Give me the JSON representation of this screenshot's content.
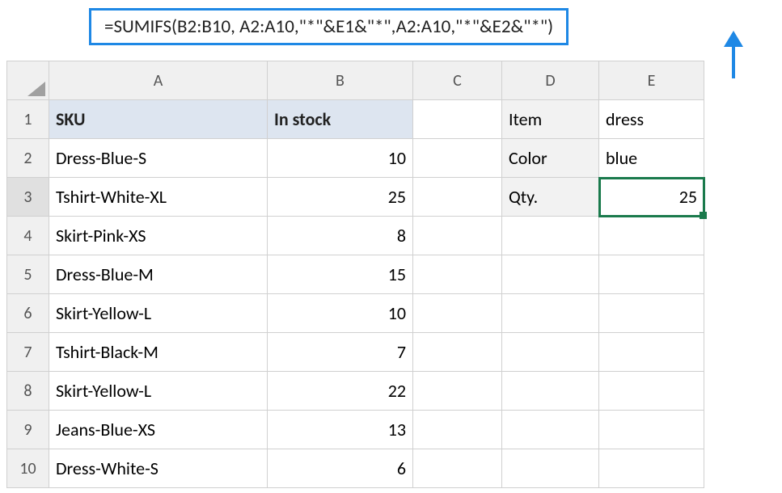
{
  "formula": "=SUMIFS(B2:B10, A2:A10,\"*\"&E1&\"*\",A2:A10,\"*\"&E2&\"*\")",
  "columns": [
    "A",
    "B",
    "C",
    "D",
    "E"
  ],
  "rowNums": [
    "1",
    "2",
    "3",
    "4",
    "5",
    "6",
    "7",
    "8",
    "9",
    "10"
  ],
  "r1": {
    "A": "SKU",
    "B": "In stock",
    "D": "Item",
    "E": "dress"
  },
  "r2": {
    "A": "Dress-Blue-S",
    "B": "10",
    "D": "Color",
    "E": "blue"
  },
  "r3": {
    "A": "Tshirt-White-XL",
    "B": "25",
    "D": "Qty.",
    "E": "25"
  },
  "r4": {
    "A": "Skirt-Pink-XS",
    "B": "8"
  },
  "r5": {
    "A": "Dress-Blue-M",
    "B": "15"
  },
  "r6": {
    "A": "Skirt-Yellow-L",
    "B": "10"
  },
  "r7": {
    "A": "Tshirt-Black-M",
    "B": "7"
  },
  "r8": {
    "A": "Skirt-Yellow-L",
    "B": "22"
  },
  "r9": {
    "A": "Jeans-Blue-XS",
    "B": "13"
  },
  "r10": {
    "A": "Dress-White-S",
    "B": "6"
  }
}
